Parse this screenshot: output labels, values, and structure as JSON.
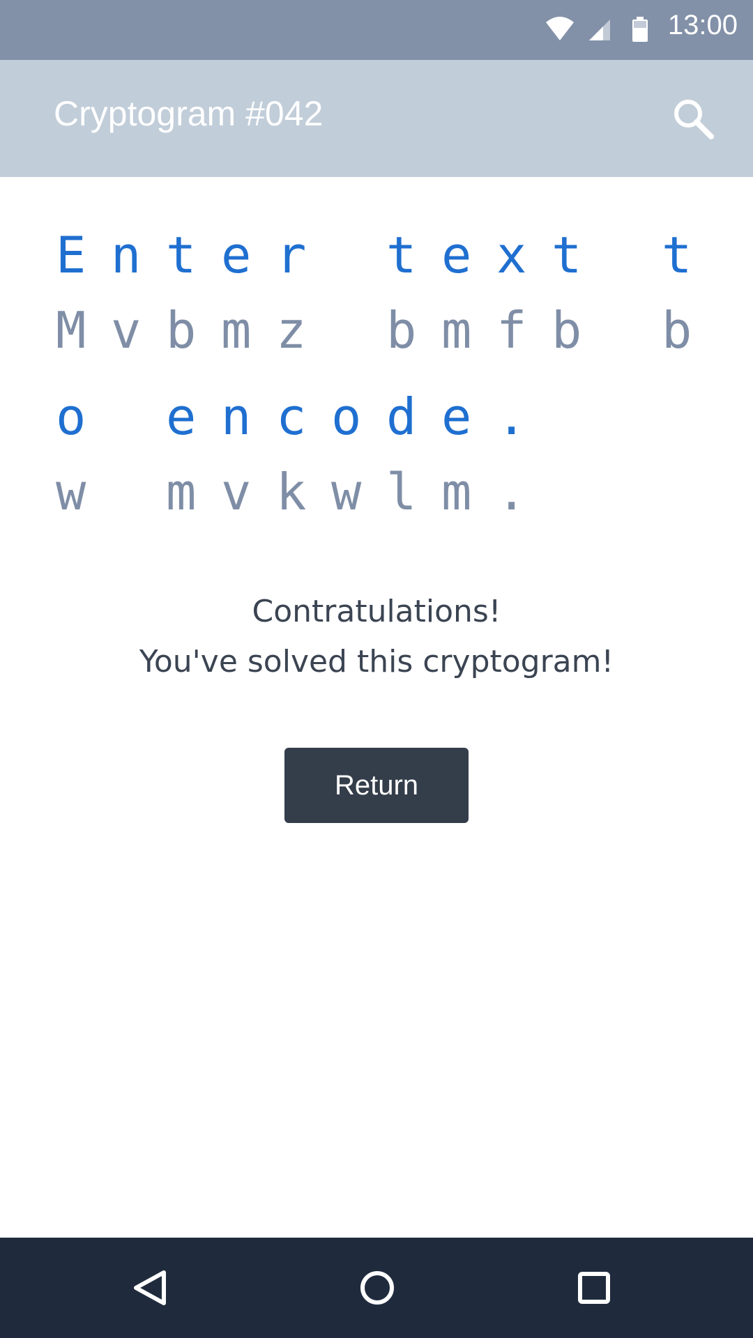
{
  "status_bar": {
    "time": "13:00",
    "icons": [
      "wifi-icon",
      "cell-signal-icon",
      "battery-icon"
    ]
  },
  "app_bar": {
    "title": "Cryptogram #042",
    "search_icon": "search-icon"
  },
  "puzzle": {
    "lines": [
      {
        "cells": [
          {
            "plain": "E",
            "cipher": "M"
          },
          {
            "plain": "n",
            "cipher": "v"
          },
          {
            "plain": "t",
            "cipher": "b"
          },
          {
            "plain": "e",
            "cipher": "m"
          },
          {
            "plain": "r",
            "cipher": "z"
          },
          {
            "plain": " ",
            "cipher": " "
          },
          {
            "plain": "t",
            "cipher": "b"
          },
          {
            "plain": "e",
            "cipher": "m"
          },
          {
            "plain": "x",
            "cipher": "f"
          },
          {
            "plain": "t",
            "cipher": "b"
          },
          {
            "plain": " ",
            "cipher": " "
          },
          {
            "plain": "t",
            "cipher": "b"
          }
        ]
      },
      {
        "cells": [
          {
            "plain": "o",
            "cipher": "w"
          },
          {
            "plain": " ",
            "cipher": " "
          },
          {
            "plain": "e",
            "cipher": "m"
          },
          {
            "plain": "n",
            "cipher": "v"
          },
          {
            "plain": "c",
            "cipher": "k"
          },
          {
            "plain": "o",
            "cipher": "w"
          },
          {
            "plain": "d",
            "cipher": "l"
          },
          {
            "plain": "e",
            "cipher": "m"
          },
          {
            "plain": ".",
            "cipher": "."
          }
        ]
      }
    ]
  },
  "message": {
    "line1": "Contratulations!",
    "line2": "You've solved this cryptogram!"
  },
  "return_button": {
    "label": "Return"
  },
  "nav_bar": {
    "icons": [
      "back-icon",
      "home-icon",
      "recents-icon"
    ]
  },
  "colors": {
    "status_bar": "#8291a8",
    "app_bar": "#c1cdd9",
    "plain_text": "#1f6fd0",
    "cipher_text": "#7f8ea6",
    "button": "#343d4a",
    "nav_bar": "#1f2b3d"
  }
}
